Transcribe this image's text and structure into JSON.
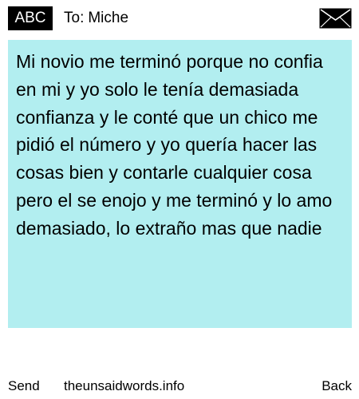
{
  "header": {
    "badge_label": "ABC",
    "to_prefix": "To:",
    "recipient_name": "Miche",
    "icon": "envelope-icon"
  },
  "message": {
    "body": "Mi novio me terminó porque no confia en mi y yo solo le tenía demasiada confianza y le conté que un chico me pidió el número y yo quería hacer las cosas bien y contarle cualquier cosa pero el se enojo y me terminó y lo amo demasiado, lo extraño mas que nadie"
  },
  "footer": {
    "send_label": "Send",
    "site_label": "theunsaidwords.info",
    "back_label": "Back"
  },
  "colors": {
    "message_background": "#b2eef0",
    "badge_background": "#000000",
    "text": "#000000"
  }
}
